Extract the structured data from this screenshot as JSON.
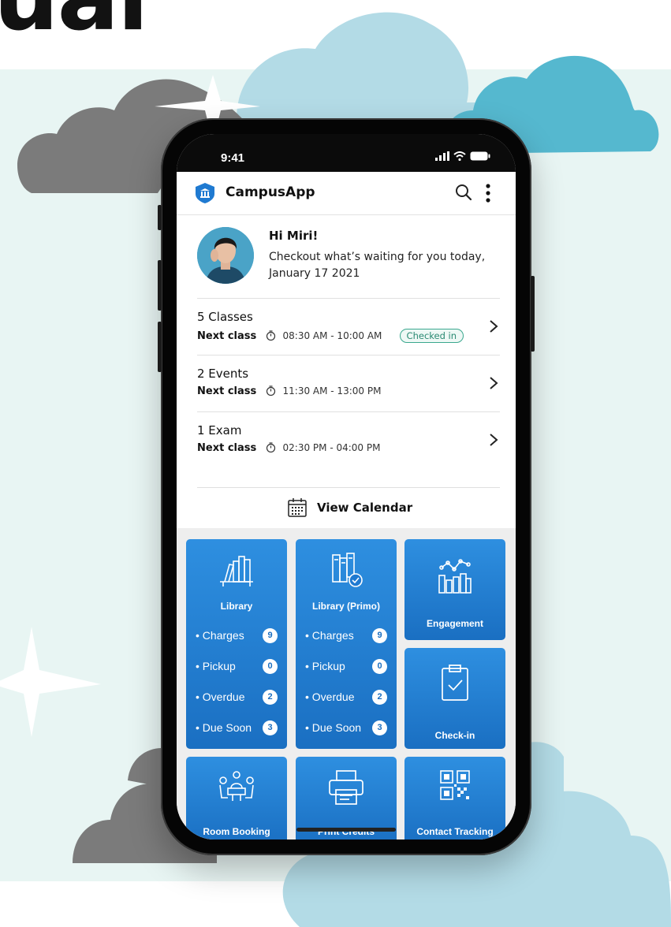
{
  "background": {
    "headline": "ual"
  },
  "status_bar": {
    "time": "9:41"
  },
  "app": {
    "title": "CampusApp"
  },
  "greeting": {
    "name": "Hi Miri!",
    "message": "Checkout what’s waiting for you today, January 17 2021"
  },
  "schedule": [
    {
      "title": "5 Classes",
      "label": "Next class",
      "time": "08:30 AM - 10:00 AM",
      "badge": "Checked in"
    },
    {
      "title": "2 Events",
      "label": "Next class",
      "time": "11:30 AM - 13:00 PM"
    },
    {
      "title": "1 Exam",
      "label": "Next class",
      "time": "02:30 PM - 04:00 PM"
    }
  ],
  "calendar": {
    "label": "View Calendar"
  },
  "tiles": {
    "library": {
      "name": "Library",
      "icon": "books-shelf-icon",
      "stats": [
        {
          "label": "• Charges",
          "count": "9"
        },
        {
          "label": "• Pickup",
          "count": "0"
        },
        {
          "label": "• Overdue",
          "count": "2"
        },
        {
          "label": "• Due Soon",
          "count": "3"
        }
      ]
    },
    "library_primo": {
      "name": "Library (Primo)",
      "icon": "books-check-icon",
      "stats": [
        {
          "label": "• Charges",
          "count": "9"
        },
        {
          "label": "• Pickup",
          "count": "0"
        },
        {
          "label": "• Overdue",
          "count": "2"
        },
        {
          "label": "• Due Soon",
          "count": "3"
        }
      ]
    },
    "engagement": {
      "name": "Engagement",
      "icon": "bar-chart-icon"
    },
    "checkin": {
      "name": "Check-in",
      "icon": "clipboard-check-icon"
    },
    "room_booking": {
      "name": "Room Booking",
      "icon": "meeting-room-icon"
    },
    "print_credits": {
      "name": "Print Credits",
      "icon": "printer-icon"
    },
    "contact_tracking": {
      "name": "Contact Tracking",
      "icon": "qr-code-icon"
    }
  },
  "colors": {
    "tile_blue": "#1a6fc2",
    "tile_blue_light": "#2e8fe0",
    "background_mint": "#e8f5f3",
    "cloud_gray": "#7b7b7b",
    "cloud_light_blue": "#b3dbe6",
    "cloud_teal": "#55b8cf",
    "badge_green": "#3aa88e"
  }
}
